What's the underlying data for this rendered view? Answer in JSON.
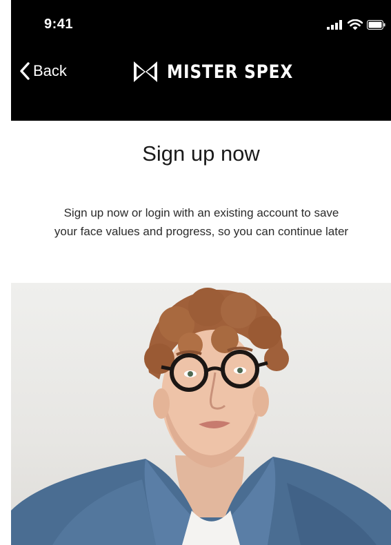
{
  "status_bar": {
    "time": "9:41",
    "icons": [
      "cellular-signal-icon",
      "wifi-icon",
      "battery-icon"
    ]
  },
  "nav": {
    "back_label": "Back",
    "brand_name": "MISTER SPEX",
    "brand_logo_icon": "mister-spex-logo-icon"
  },
  "main": {
    "title": "Sign up now",
    "description": "Sign up now or login with an existing account to save your face values and progress, so you can continue later"
  },
  "colors": {
    "header_bg": "#000000",
    "header_text": "#ffffff",
    "body_bg": "#ffffff",
    "text": "#1a1a1a",
    "shirt_denim": "#4a6d92"
  }
}
